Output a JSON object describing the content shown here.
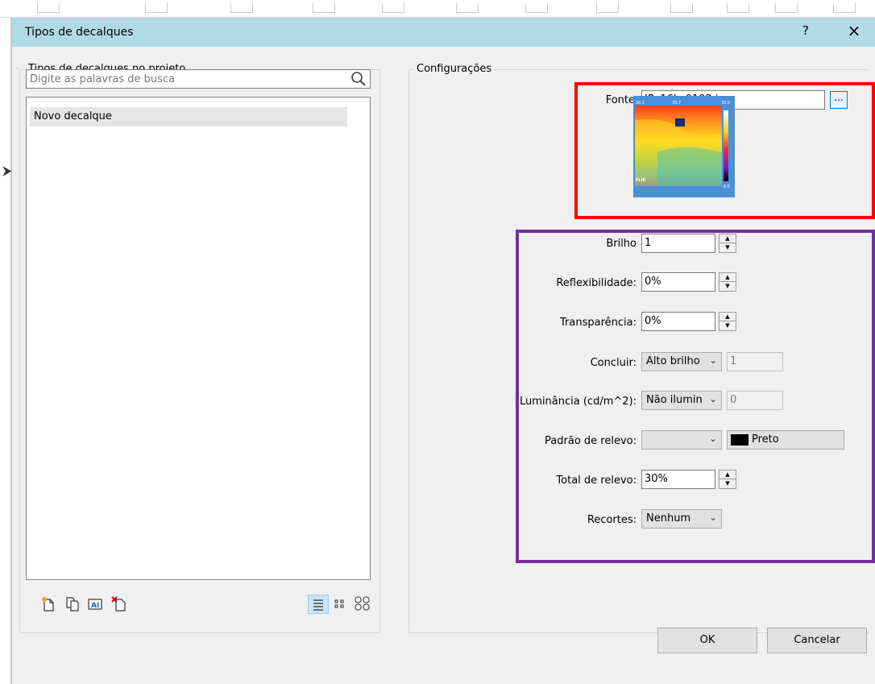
{
  "dialog": {
    "title": "Tipos de decalques",
    "help_label": "?",
    "close_label": "×"
  },
  "left_panel": {
    "group_label": "Tipos de decalques no projeto",
    "search": {
      "placeholder": "Digite as palavras de busca",
      "value": ""
    },
    "items": [
      {
        "label": "Novo decalque",
        "selected": true
      }
    ],
    "toolbar": [
      {
        "name": "new-decal-icon"
      },
      {
        "name": "duplicate-icon"
      },
      {
        "name": "rename-icon"
      },
      {
        "name": "delete-decal-icon"
      }
    ],
    "view_modes": [
      {
        "name": "list-view-icon",
        "active": true
      },
      {
        "name": "small-icons-view-icon",
        "active": false
      },
      {
        "name": "large-icons-view-icon",
        "active": false
      }
    ]
  },
  "settings": {
    "group_label": "Configurações",
    "source": {
      "label": "Fonte",
      "value": "IR_16h_0102.jpg",
      "browse_label": "..."
    },
    "thumbnail": {
      "top_left": "26.1",
      "top_mid": "30.7",
      "top_right": "30,0",
      "bottom_right": "8,0",
      "logo": "FLIR"
    },
    "brightness": {
      "label": "Brilho",
      "value": "1"
    },
    "reflectivity": {
      "label": "Reflexibilidade:",
      "value": "0%"
    },
    "transparency": {
      "label": "Transparência:",
      "value": "0%"
    },
    "finish": {
      "label": "Concluir:",
      "value": "Alto brilho",
      "extra": "1"
    },
    "luminance": {
      "label": "Luminância (cd/m^2):",
      "value": "Não ilumin",
      "extra": "0"
    },
    "bump_pattern": {
      "label": "Padrão de relevo:",
      "value": "",
      "color_label": "Preto",
      "color": "#000000"
    },
    "bump_amount": {
      "label": "Total de relevo:",
      "value": "30%"
    },
    "cutouts": {
      "label": "Recortes:",
      "value": "Nenhum"
    }
  },
  "buttons": {
    "ok": "OK",
    "cancel": "Cancelar"
  },
  "annotations": {
    "red_box_color": "#ff0000",
    "purple_box_color": "#7030a0"
  }
}
